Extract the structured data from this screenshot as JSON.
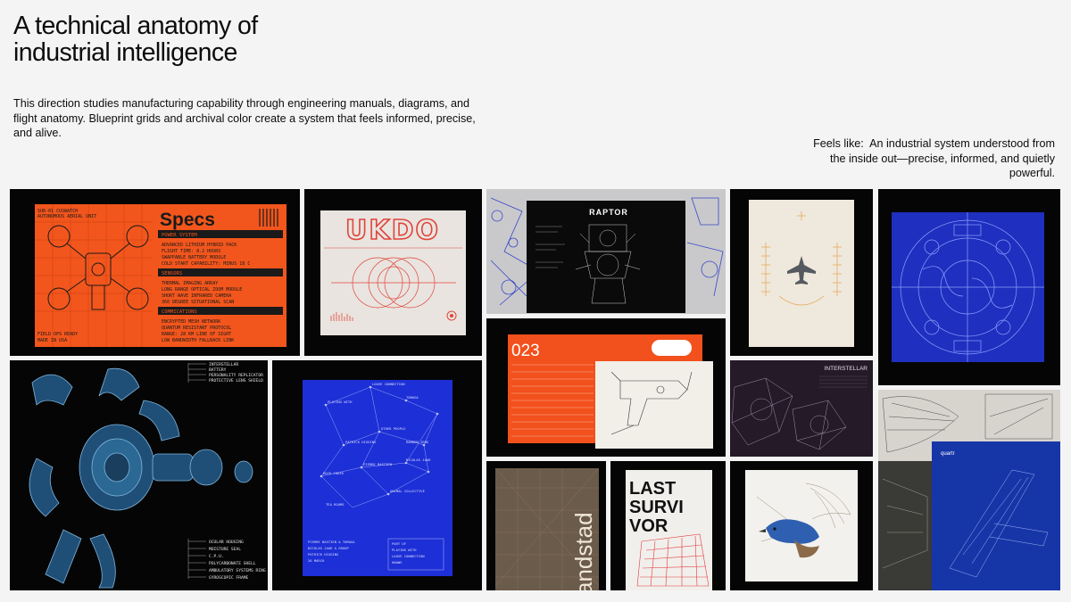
{
  "header": {
    "title_line1": "A technical anatomy of",
    "title_line2": "industrial intelligence",
    "description": "This direction studies manufacturing capability through engineering manuals, diagrams, and flight anatomy. Blueprint grids and archival color create a system that feels informed, precise, and alive.",
    "feels_like_label": "Feels like:",
    "feels_like_text": "An industrial system understood from the inside out—precise, informed, and quietly powerful."
  },
  "specs": {
    "small1": "SUR-01 CUSWATCH",
    "small2": "AUTONOMOUS AERIAL UNIT",
    "title": "Specs",
    "power_label": "POWER SYSTEM",
    "power_items": [
      "ADVANCED LITHIUM HYBRID PACK",
      "FLIGHT TIME: 8.2 HOURS",
      "SWAPPABLE BATTERY MODULE",
      "COLD START CAPABILITY: MINUS 18 C"
    ],
    "sensors_label": "SENSORS",
    "sensors_items": [
      "THERMAL IMAGING ARRAY",
      "LONG RANGE OPTICAL ZOOM MODULE",
      "SHORT WAVE INFRARED CAMERA",
      "360 DEGREE SITUATIONAL SCAN"
    ],
    "comms_label": "COMMICATIONS",
    "comms_items": [
      "ENCRYPTED MESH NETWORK",
      "QUANTUM RESISTANT PROTOCOL",
      "RANGE: 28 KM LINE OF SIGHT",
      "LOW BANDWIDTH FALLBACK LINK"
    ],
    "footer1": "FIELD OPS READY",
    "footer2": "MADE IN USA"
  },
  "ukdo": {
    "logo": "UKDO"
  },
  "raptor": {
    "title": "RAPTOR"
  },
  "orange_card": {
    "number": "023"
  },
  "robot": {
    "labels_top": [
      "INTERSTELLAR",
      "BATTERY",
      "PERSONALITY REPLICATOR",
      "PROTECTIVE LENS SHIELD"
    ],
    "labels_bottom": [
      "OCULAR HOUSING",
      "MOISTURE SEAL",
      "C.P.U.",
      "POLYCARBONATE SHELL",
      "AMBULATORY SYSTEMS RING",
      "GYROSCOPIC FRAME"
    ]
  },
  "network": {
    "nodes": [
      "PLAYING WITH",
      "LOOSE CONNECTION",
      "PATRICK HIGGINS",
      "OTHER PEOPLE",
      "PIERRE BASTIEN",
      "TOMAGA",
      "NICOLAS JAAR",
      "ROCK CHOIR",
      "ANIMAL COLLECTIVE",
      "RAMDEN JENS",
      "TEA ROOMS"
    ],
    "footer_text": [
      "PIERRE BASTIEN & TOMAGA",
      "NICOLAS JAAR & GROUP",
      "PATRICK HIGGINS",
      "26 MARCH"
    ],
    "legend": [
      "PART OF",
      "PLAYING WITH",
      "LOOSE CONNECTION",
      "KNOWS"
    ]
  },
  "interstellar": {
    "title": "INTERSTELLAR"
  },
  "sandstad": {
    "word": "andstad"
  },
  "last_survivor": {
    "line1": "LAST",
    "line2": "SURVI",
    "line3": "VOR"
  },
  "quartr": {
    "brand": "quartr"
  }
}
